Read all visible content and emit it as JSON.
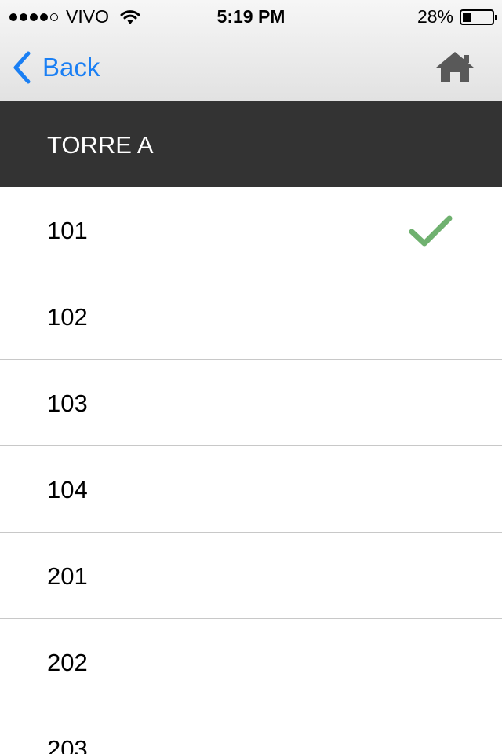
{
  "status_bar": {
    "carrier": "VIVO",
    "time": "5:19 PM",
    "battery_text": "28%",
    "battery_level": 0.28,
    "signal_dots_filled": 4,
    "signal_dots_total": 5
  },
  "nav": {
    "back_label": "Back",
    "accent_color": "#1a7ff4"
  },
  "section": {
    "title": "TORRE A"
  },
  "items": [
    {
      "label": "101",
      "selected": true
    },
    {
      "label": "102",
      "selected": false
    },
    {
      "label": "103",
      "selected": false
    },
    {
      "label": "104",
      "selected": false
    },
    {
      "label": "201",
      "selected": false
    },
    {
      "label": "202",
      "selected": false
    },
    {
      "label": "203",
      "selected": false
    }
  ],
  "colors": {
    "header_bg": "#333333",
    "check": "#6fb16f"
  }
}
